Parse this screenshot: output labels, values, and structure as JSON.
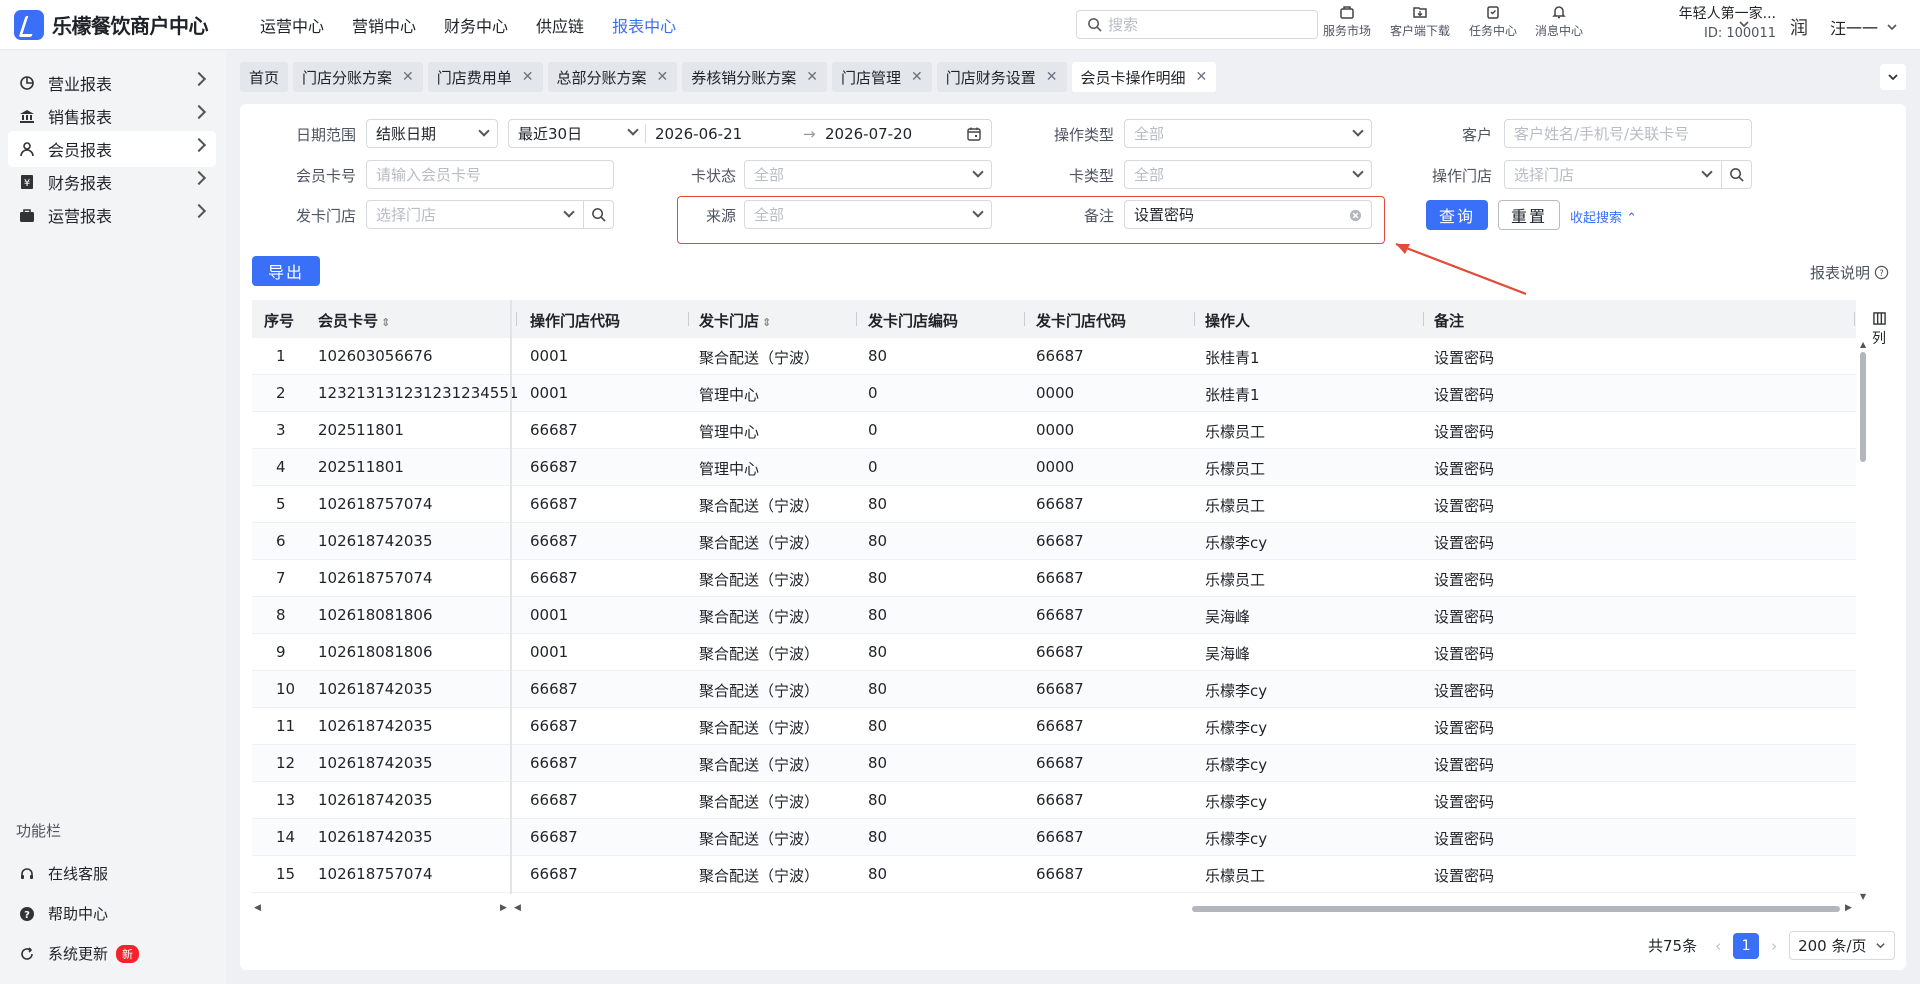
{
  "app": {
    "name": "乐檬餐饮商户中心"
  },
  "topnav": [
    "运营中心",
    "营销中心",
    "财务中心",
    "供应链",
    "报表中心"
  ],
  "search": {
    "placeholder": "搜索"
  },
  "tools": [
    "服务市场",
    "客户端下载",
    "任务中心",
    "消息中心"
  ],
  "user": {
    "org": "年轻人第一家...",
    "id": "ID: 100011",
    "avatar_text": "润",
    "name": "汪一一"
  },
  "sidebar": [
    "营业报表",
    "销售报表",
    "会员报表",
    "财务报表",
    "运营报表"
  ],
  "func": {
    "title": "功能栏",
    "items": [
      "在线客服",
      "帮助中心",
      "系统更新"
    ],
    "new_badge": "新"
  },
  "tabs": [
    {
      "label": "首页"
    },
    {
      "label": "门店分账方案"
    },
    {
      "label": "门店费用单"
    },
    {
      "label": "总部分账方案"
    },
    {
      "label": "券核销分账方案"
    },
    {
      "label": "门店管理"
    },
    {
      "label": "门店财务设置"
    },
    {
      "label": "会员卡操作明细"
    }
  ],
  "filters": {
    "date_range_label": "日期范围",
    "date_type": "结账日期",
    "date_preset": "最近30日",
    "date_start": "2026-06-21",
    "date_end": "2026-07-20",
    "op_type_label": "操作类型",
    "op_type_ph": "全部",
    "customer_label": "客户",
    "customer_ph": "客户姓名/手机号/关联卡号",
    "card_no_label": "会员卡号",
    "card_no_ph": "请输入会员卡号",
    "card_status_label": "卡状态",
    "card_status_ph": "全部",
    "card_type_label": "卡类型",
    "card_type_ph": "全部",
    "op_store_label": "操作门店",
    "op_store_ph": "选择门店",
    "issue_store_label": "发卡门店",
    "issue_store_ph": "选择门店",
    "source_label": "来源",
    "source_ph": "全部",
    "remark_label": "备注",
    "remark_value": "设置密码"
  },
  "buttons": {
    "query": "查询",
    "reset": "重置",
    "collapse": "收起搜索",
    "export": "导出",
    "report_help": "报表说明"
  },
  "table": {
    "columns": [
      "序号",
      "会员卡号",
      "操作门店代码",
      "发卡门店",
      "发卡门店编码",
      "发卡门店代码",
      "操作人",
      "备注"
    ],
    "rows": [
      [
        "1",
        "102603056676",
        "0001",
        "聚合配送（宁波）",
        "80",
        "66687",
        "张桂青1",
        "设置密码"
      ],
      [
        "2",
        "123213131231231234551",
        "0001",
        "管理中心",
        "0",
        "0000",
        "张桂青1",
        "设置密码"
      ],
      [
        "3",
        "202511801",
        "66687",
        "管理中心",
        "0",
        "0000",
        "乐檬员工",
        "设置密码"
      ],
      [
        "4",
        "202511801",
        "66687",
        "管理中心",
        "0",
        "0000",
        "乐檬员工",
        "设置密码"
      ],
      [
        "5",
        "102618757074",
        "66687",
        "聚合配送（宁波）",
        "80",
        "66687",
        "乐檬员工",
        "设置密码"
      ],
      [
        "6",
        "102618742035",
        "66687",
        "聚合配送（宁波）",
        "80",
        "66687",
        "乐檬李cy",
        "设置密码"
      ],
      [
        "7",
        "102618757074",
        "66687",
        "聚合配送（宁波）",
        "80",
        "66687",
        "乐檬员工",
        "设置密码"
      ],
      [
        "8",
        "102618081806",
        "0001",
        "聚合配送（宁波）",
        "80",
        "66687",
        "吴海峰",
        "设置密码"
      ],
      [
        "9",
        "102618081806",
        "0001",
        "聚合配送（宁波）",
        "80",
        "66687",
        "吴海峰",
        "设置密码"
      ],
      [
        "10",
        "102618742035",
        "66687",
        "聚合配送（宁波）",
        "80",
        "66687",
        "乐檬李cy",
        "设置密码"
      ],
      [
        "11",
        "102618742035",
        "66687",
        "聚合配送（宁波）",
        "80",
        "66687",
        "乐檬李cy",
        "设置密码"
      ],
      [
        "12",
        "102618742035",
        "66687",
        "聚合配送（宁波）",
        "80",
        "66687",
        "乐檬李cy",
        "设置密码"
      ],
      [
        "13",
        "102618742035",
        "66687",
        "聚合配送（宁波）",
        "80",
        "66687",
        "乐檬李cy",
        "设置密码"
      ],
      [
        "14",
        "102618742035",
        "66687",
        "聚合配送（宁波）",
        "80",
        "66687",
        "乐檬李cy",
        "设置密码"
      ],
      [
        "15",
        "102618757074",
        "66687",
        "聚合配送（宁波）",
        "80",
        "66687",
        "乐檬员工",
        "设置密码"
      ]
    ],
    "column_settings": "列"
  },
  "pager": {
    "total": "共75条",
    "current": "1",
    "page_size": "200 条/页"
  },
  "colors": {
    "accent": "#3a6ff7",
    "highlight": "#e34a3a",
    "badge": "#f5222d"
  }
}
